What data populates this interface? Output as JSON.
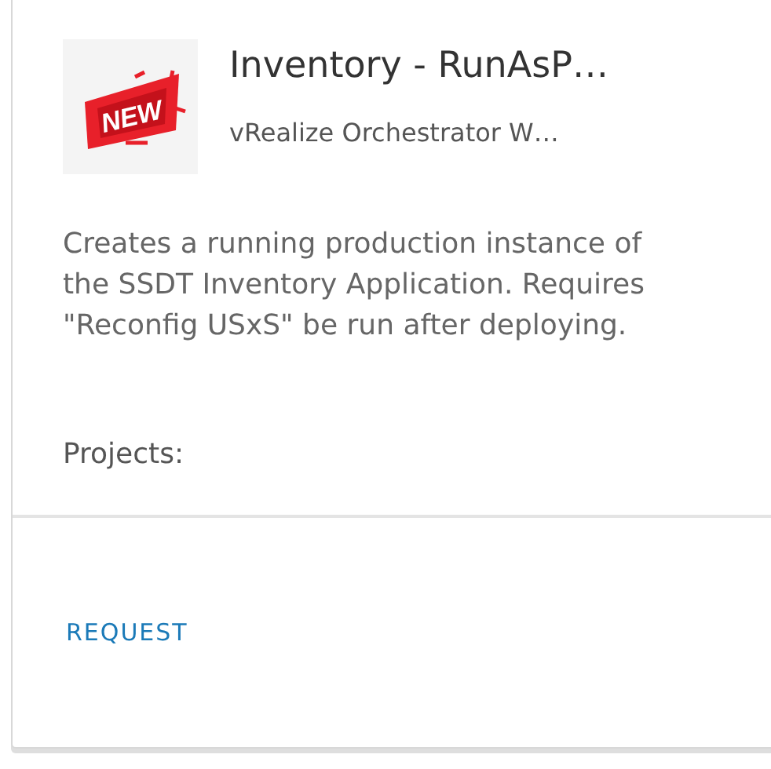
{
  "card": {
    "icon_text": "NEW",
    "title": "Inventory - RunAsP…",
    "subtitle": "vRealize Orchestrator W…",
    "description": "Creates a running production instance of the SSDT Inventory Application. Requires \"Reconfig USxS\" be run after deploying.",
    "projects_label": "Projects:",
    "actions": [
      "REQUEST"
    ]
  }
}
